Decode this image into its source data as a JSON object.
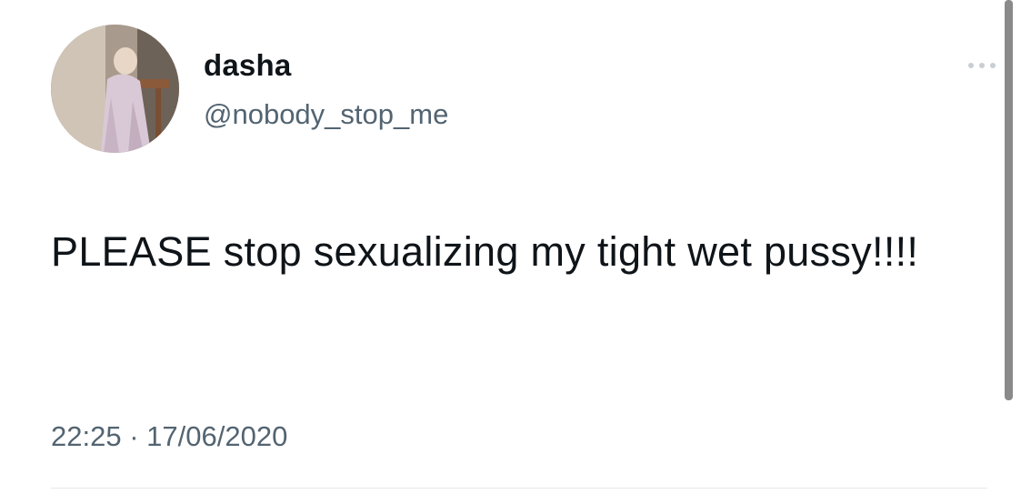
{
  "tweet": {
    "author": {
      "display_name": "dasha",
      "handle": "@nobody_stop_me",
      "avatar_icon": "profile-photo"
    },
    "text": "PLEASE stop sexualizing my tight wet pussy!!!!",
    "time": "22:25",
    "separator": "·",
    "date": "17/06/2020",
    "more_icon": "ellipsis-icon"
  },
  "colors": {
    "text_primary": "#0f1419",
    "text_secondary": "#536471",
    "background": "#ffffff",
    "scrollbar": "#8a8a8a"
  }
}
